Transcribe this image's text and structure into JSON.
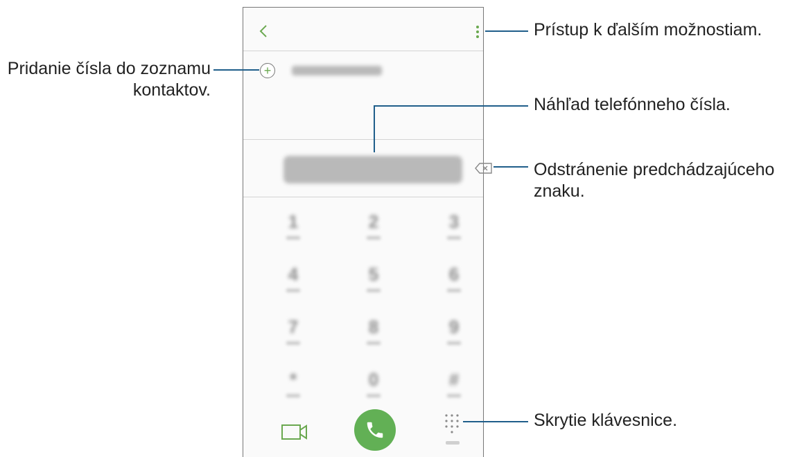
{
  "labels": {
    "more_options": "Prístup k ďalším možnostiam.",
    "add_contact_line1": "Pridanie čísla do zoznamu",
    "add_contact_line2": "kontaktov.",
    "number_preview": "Náhľad telefónneho čísla.",
    "delete_line1": "Odstránenie predchádzajúceho",
    "delete_line2": "znaku.",
    "hide_keypad": "Skrytie klávesnice."
  },
  "dialer": {
    "keys": [
      "1",
      "2",
      "3",
      "4",
      "5",
      "6",
      "7",
      "8",
      "9",
      "*",
      "0",
      "#"
    ]
  },
  "colors": {
    "accent": "#6aa84f",
    "call_button": "#62b055",
    "leader_line": "#1f5e8a"
  },
  "icons": [
    "back-icon",
    "more-options-icon",
    "add-contact-icon",
    "backspace-icon",
    "video-call-icon",
    "phone-icon",
    "keypad-icon"
  ]
}
